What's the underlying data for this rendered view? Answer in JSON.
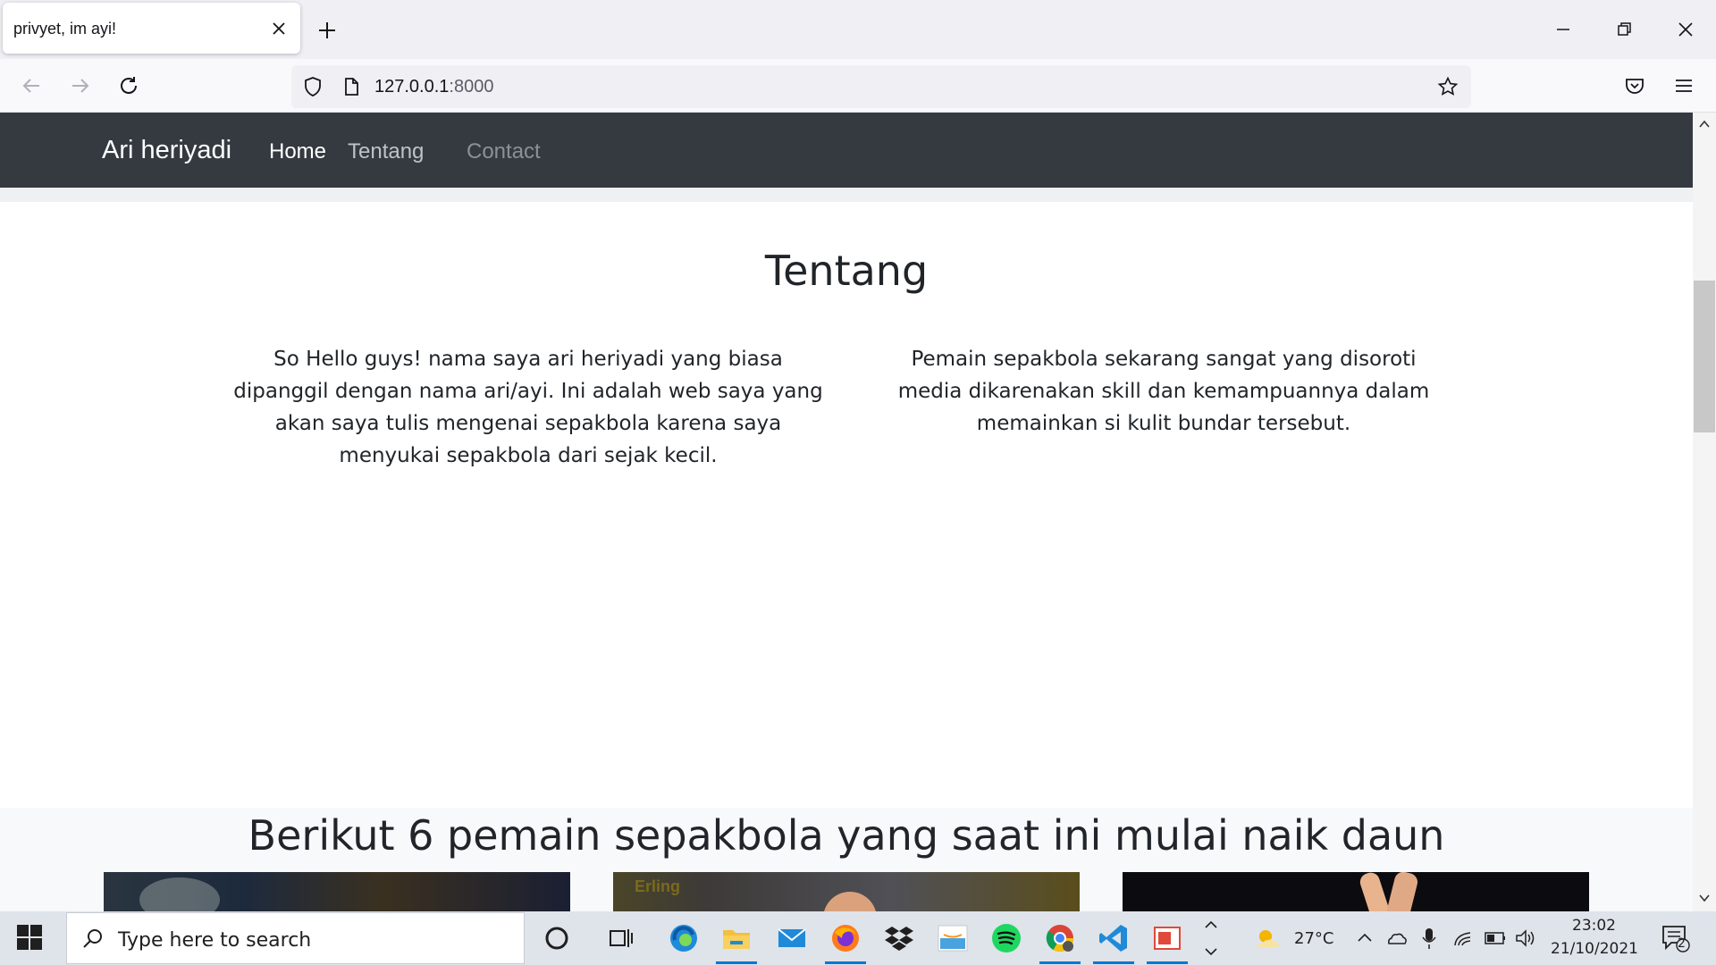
{
  "browser": {
    "tab_title": "privyet, im ayi!",
    "url_host": "127.0.0.1",
    "url_port": ":8000"
  },
  "site": {
    "brand": "Ari heriyadi",
    "nav": [
      "Home",
      "Tentang",
      "Contact"
    ],
    "about_title": "Tentang",
    "col_left": "So Hello guys! nama saya ari heriyadi yang biasa dipanggil dengan nama ari/ayi. Ini adalah web saya yang akan saya tulis mengenai sepakbola karena saya menyukai sepakbola dari sejak kecil.",
    "col_right": "Pemain sepakbola sekarang sangat yang disoroti media dikarenakan skill dan kemampuannya dalam memainkan si kulit bundar tersebut.",
    "players_title": "Berikut 6 pemain sepakbola yang saat ini mulai naik daun",
    "card2_caption": "Erling"
  },
  "taskbar": {
    "search_placeholder": "Type here to search",
    "weather": "27°C",
    "time": "23:02",
    "date": "21/10/2021",
    "notifications": "2",
    "apps": [
      "cortana-icon",
      "task-view-icon",
      "edge-icon",
      "file-explorer-icon",
      "mail-icon",
      "firefox-icon",
      "dropbox-icon",
      "amazon-icon",
      "spotify-icon",
      "chrome-icon",
      "vscode-icon",
      "office-icon"
    ]
  },
  "colors": {
    "site_nav_bg": "#343a40",
    "nav_active": "#ffffff",
    "nav_muted": "#bfc2c6",
    "nav_disabled": "#8d9195",
    "accent": "#0078d4"
  }
}
